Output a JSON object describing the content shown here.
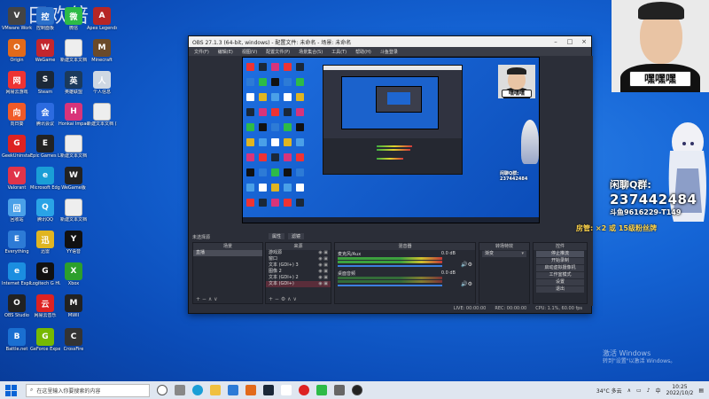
{
  "desktop": {
    "watermark": "田欢倍",
    "icons": [
      {
        "label": "VMware Workstation Pro",
        "color": "#444",
        "glyph": "V"
      },
      {
        "label": "Origin",
        "color": "#e26a1b",
        "glyph": "O"
      },
      {
        "label": "网易云游戏",
        "color": "#e33",
        "glyph": "网"
      },
      {
        "label": "向日葵",
        "color": "#f05a28",
        "glyph": "向"
      },
      {
        "label": "GeekUninstaller",
        "color": "#d22",
        "glyph": "G"
      },
      {
        "label": "Valorant",
        "color": "#e0344a",
        "glyph": "V"
      },
      {
        "label": "回收站",
        "color": "#4aa0e8",
        "glyph": "回"
      },
      {
        "label": "Everything",
        "color": "#2d7bd6",
        "glyph": "E"
      },
      {
        "label": "Internet Explorer",
        "color": "#1b8ee0",
        "glyph": "e"
      },
      {
        "label": "OBS Studio",
        "color": "#222",
        "glyph": "O"
      },
      {
        "label": "Battle.net",
        "color": "#1a6fd1",
        "glyph": "B"
      },
      {
        "label": "控制面板",
        "color": "#2b6fc9",
        "glyph": "控"
      },
      {
        "label": "WeGame",
        "color": "#c3262e",
        "glyph": "W"
      },
      {
        "label": "Steam",
        "color": "#1b2838",
        "glyph": "S"
      },
      {
        "label": "腾讯会议",
        "color": "#2c6be0",
        "glyph": "会"
      },
      {
        "label": "Epic Games Launcher",
        "color": "#222",
        "glyph": "E"
      },
      {
        "label": "Microsoft Edge",
        "color": "#1a9ed6",
        "glyph": "e"
      },
      {
        "label": "腾讯QQ",
        "color": "#2aa3e6",
        "glyph": "Q"
      },
      {
        "label": "迅雷",
        "color": "#e0b521",
        "glyph": "迅"
      },
      {
        "label": "Logitech G HUB",
        "color": "#111",
        "glyph": "G"
      },
      {
        "label": "网易云音乐",
        "color": "#d22",
        "glyph": "云"
      },
      {
        "label": "GeForce Experience",
        "color": "#76b900",
        "glyph": "G"
      },
      {
        "label": "微信",
        "color": "#2dbb47",
        "glyph": "微"
      },
      {
        "label": "新建文本文档",
        "color": "#eee",
        "glyph": " "
      },
      {
        "label": "英雄联盟",
        "color": "#1b3a5c",
        "glyph": "英"
      },
      {
        "label": "Honkai Impact",
        "color": "#d8347a",
        "glyph": "H"
      },
      {
        "label": "新建文本文档",
        "color": "#eee",
        "glyph": " "
      },
      {
        "label": "WeGame版",
        "color": "#222",
        "glyph": "W"
      },
      {
        "label": "新建文本文档",
        "color": "#eee",
        "glyph": " "
      },
      {
        "label": "YY语音",
        "color": "#111",
        "glyph": "Y"
      },
      {
        "label": "Xbox",
        "color": "#2c9f2c",
        "glyph": "X"
      },
      {
        "label": "MWII",
        "color": "#222",
        "glyph": "M"
      },
      {
        "label": "CrossFire",
        "color": "#333",
        "glyph": "C"
      },
      {
        "label": "Apex Legends",
        "color": "#b62626",
        "glyph": "A"
      },
      {
        "label": "Minecraft",
        "color": "#6a4a2a",
        "glyph": "M"
      },
      {
        "label": "个人信息",
        "color": "#cfd8e3",
        "glyph": "人"
      },
      {
        "label": "新建文本文档 (2)",
        "color": "#eee",
        "glyph": " "
      }
    ]
  },
  "obs": {
    "title": "OBS 27.1.3 (64-bit, windows) - 配置文件: 未命名 - 场景: 未命名",
    "menu": [
      "文件(F)",
      "编辑(E)",
      "视图(V)",
      "配置文件(P)",
      "场景集合(S)",
      "工具(T)",
      "帮助(H)",
      "斗鱼登录"
    ],
    "no_source": "未选择源",
    "tabs": [
      "属性",
      "滤镜"
    ],
    "scenes_header": "场景",
    "scenes": [
      "直播"
    ],
    "sources_header": "来源",
    "sources": [
      "游戏源",
      "窗口",
      "文本 (GDI+) 3",
      "图像 2",
      "文本 (GDI+) 2",
      "文本 (GDI+)"
    ],
    "mixer_header": "混音器",
    "mixer": [
      {
        "name": "麦克风/Aux",
        "db": "0.0 dB"
      },
      {
        "name": "桌面音频",
        "db": "0.0 dB"
      }
    ],
    "transitions_header": "转场特效",
    "transition_value": "渐变",
    "controls_header": "控件",
    "controls": [
      "停止推流",
      "开始录制",
      "启动虚拟摄像机",
      "工作室模式",
      "设置",
      "退出"
    ],
    "status": {
      "live": "LIVE: 00:00:00",
      "rec": "REC: 00:00:00",
      "cpu": "CPU: 1.1%, 60.00 fps"
    }
  },
  "overlay": {
    "cam_caption": "嘿嘿嘿",
    "qq_title": "闲聊Q群:",
    "qq_number": "237442484",
    "douyu_id": "斗鱼9616229-T149",
    "room_text": "房管: ×2 或 15级粉丝牌"
  },
  "windows": {
    "activate_title": "激活 Windows",
    "activate_sub": "转到\"设置\"以激活 Windows。"
  },
  "taskbar": {
    "search_placeholder": "在这里输入你要搜索的内容",
    "weather": "34°C 多云",
    "ime": "中",
    "time": "10:25",
    "date": "2022/10/2"
  },
  "colors": {
    "accent": "#0b4cb8",
    "obs_bg": "#2b2e38",
    "room_text": "#ffd44a"
  }
}
